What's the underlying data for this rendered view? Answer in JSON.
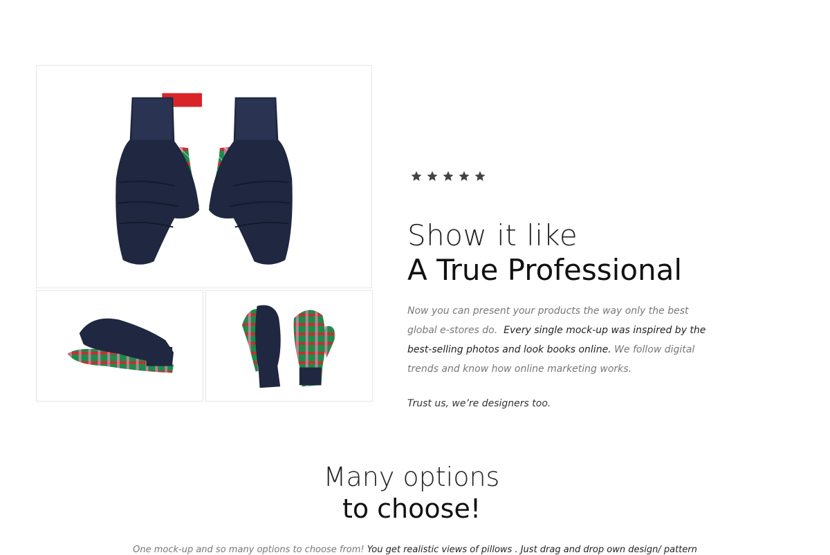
{
  "gallery": {
    "main_image": "mittens-front-view",
    "thumbnails": [
      "mitten-side-view",
      "mittens-palm-view"
    ],
    "colors": {
      "glove_navy": "#1f2840",
      "plaid_green": "#1e8a4c",
      "plaid_red": "#d9252a",
      "plaid_pink": "#e98bb0"
    }
  },
  "rating": {
    "stars": 5,
    "icon": "star-icon",
    "color": "#444444"
  },
  "hero": {
    "heading_light": "Show it like",
    "heading_bold": "A True Professional",
    "paragraph_part1": "Now you can present your products the way only the best global e-stores do.",
    "paragraph_part2": "Every single mock-up was inspired by the best-selling photos and look books online.",
    "paragraph_part3": "We follow digital trends and know how online marketing works.",
    "tagline": "Trust us, we’re designers too."
  },
  "options": {
    "heading_light": "Many options",
    "heading_bold": "to choose!",
    "description_part1": "One mock-up and so many options to choose from!",
    "description_part2": "You get realistic views of pillows . Just drag and drop own design/ pattern"
  }
}
